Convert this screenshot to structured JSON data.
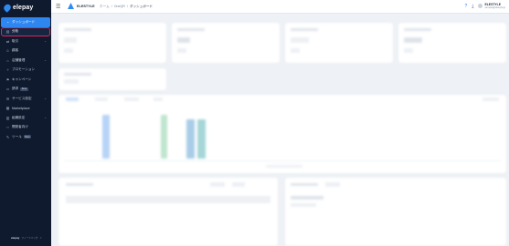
{
  "sidebar": {
    "logo_text": "elepay",
    "items": [
      {
        "label": "ダッシュボード",
        "icon": "dashboard-icon",
        "glyph": "◔",
        "badge": "",
        "chevron": "",
        "active": true
      },
      {
        "label": "分析",
        "icon": "analytics-icon",
        "glyph": "▤",
        "badge": "",
        "chevron": "",
        "focused": true
      },
      {
        "label": "取引",
        "icon": "transactions-icon",
        "glyph": "⇄",
        "badge": "",
        "chevron": "⌄"
      },
      {
        "label": "顧客",
        "icon": "customers-icon",
        "glyph": "☺",
        "badge": "",
        "chevron": ""
      },
      {
        "label": "店舗管理",
        "icon": "store-icon",
        "glyph": "⌂",
        "badge": "",
        "chevron": "⌄"
      },
      {
        "label": "プロモーション",
        "icon": "promotion-icon",
        "glyph": "✧",
        "badge": "",
        "chevron": ""
      },
      {
        "label": "キャンペーン",
        "icon": "campaign-icon",
        "glyph": "⚑",
        "badge": "",
        "chevron": ""
      },
      {
        "label": "請求",
        "icon": "billing-icon",
        "glyph": "▭",
        "badge": "Beta",
        "chevron": ""
      },
      {
        "label": "サービス設定",
        "icon": "service-settings-icon",
        "glyph": "⚙",
        "badge": "",
        "chevron": "⌄"
      },
      {
        "label": "Marketplace",
        "icon": "marketplace-icon",
        "glyph": "▦",
        "badge": "",
        "chevron": ""
      },
      {
        "label": "組織設定",
        "icon": "organization-icon",
        "glyph": "▥",
        "badge": "",
        "chevron": "⌄"
      },
      {
        "label": "開発者向け",
        "icon": "developer-icon",
        "glyph": "‹›",
        "badge": "",
        "chevron": ""
      },
      {
        "label": "ツール",
        "icon": "tools-icon",
        "glyph": "✎",
        "badge": "Beta",
        "chevron": ""
      }
    ],
    "footer_label": "elepay",
    "footer_text": "フィードバック"
  },
  "header": {
    "menu_icon": "☰",
    "brand_name": "ELESTYLE",
    "breadcrumbs": [
      "ホーム",
      "/",
      "OneQR",
      "/",
      "ダッシュボード"
    ],
    "help_icon": "?",
    "download_icon": "⤓",
    "user_name": "ELESTYLE",
    "user_email": "sample@elestyle.jp"
  },
  "colors": {
    "accent": "#2e86f0",
    "sidebar_bg": "#0f1a2e",
    "focus_ring": "#e0245e"
  }
}
